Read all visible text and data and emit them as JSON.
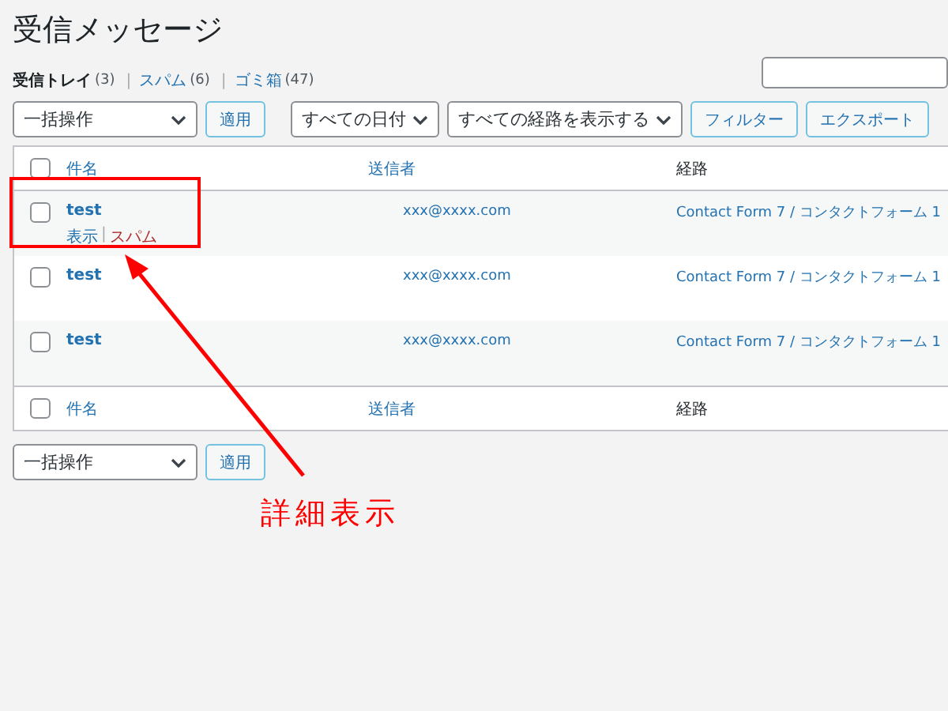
{
  "page_title": "受信メッセージ",
  "views": {
    "separator": "|",
    "items": [
      {
        "label": "受信トレイ",
        "count": "(3)",
        "selected": true
      },
      {
        "label": "スパム",
        "count": "(6)",
        "selected": false
      },
      {
        "label": "ゴミ箱",
        "count": "(47)",
        "selected": false
      }
    ]
  },
  "top_toolbar": {
    "bulk_action": "一括操作",
    "apply": "適用",
    "date_filter": "すべての日付",
    "route_filter": "すべての経路を表示する",
    "filter_button": "フィルター",
    "export_button": "エクスポート"
  },
  "table": {
    "header": {
      "checked": false,
      "columns": [
        "件名",
        "送信者",
        "経路"
      ]
    },
    "rows": [
      {
        "checked": false,
        "subject": "test",
        "sender": "xxx@xxxx.com",
        "route": "Contact Form 7 / コンタクトフォーム 1",
        "row_action_separator": "|",
        "row_actions": [
          {
            "label": "表示",
            "kind": "view"
          },
          {
            "label": "スパム",
            "kind": "spam"
          }
        ]
      },
      {
        "checked": false,
        "subject": "test",
        "sender": "xxx@xxxx.com",
        "route": "Contact Form 7 / コンタクトフォーム 1"
      },
      {
        "checked": false,
        "subject": "test",
        "sender": "xxx@xxxx.com",
        "route": "Contact Form 7 / コンタクトフォーム 1"
      }
    ],
    "footer": {
      "checked": false,
      "columns": [
        "件名",
        "送信者",
        "経路"
      ]
    }
  },
  "bottom_toolbar": {
    "bulk_action": "一括操作",
    "apply": "適用"
  },
  "annotation": {
    "label": "詳細表示"
  }
}
